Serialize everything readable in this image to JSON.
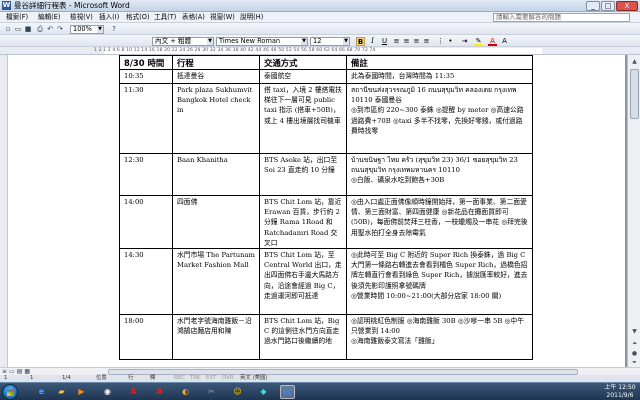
{
  "window": {
    "title": "曼谷詳細行程表 - Microsoft Word",
    "buttons": {
      "minimize": "_",
      "maximize": "□",
      "close": "X"
    }
  },
  "menubar": {
    "items": [
      "檔案(F)",
      "編輯(E)",
      "檢視(V)",
      "插入(I)",
      "格式(O)",
      "工具(T)",
      "表格(A)",
      "視窗(W)",
      "說明(H)"
    ],
    "help_placeholder": "請輸入需要解答的問題"
  },
  "toolbar": {
    "zoom": "100%",
    "style": "內文 + 粗體",
    "font": "Times New Roman",
    "font_size": "12",
    "bold": "B",
    "italic": "I",
    "underline": "U",
    "char_a": "A"
  },
  "ruler": {
    "numbers": "1  2  1      2  4  6  8  10  12  14  16  18  20  22  24  26  28  30  32  34  36  38  40  42  44  46  48  50  52  54  56  58  60  62  64  66  68  70  72  74"
  },
  "document": {
    "headers": [
      "8/30 時間",
      "行程",
      "交通方式",
      "備註"
    ],
    "rows": [
      {
        "time": "10:35",
        "itinerary": "抵達曼谷",
        "transport": "泰國航空",
        "notes": "此為泰國時間，台灣時間為 11:35"
      },
      {
        "time": "11:30",
        "itinerary": "Park plaza Sukhumvit Bangkok Hotel check in",
        "transport": "搭 taxi，入境 2 樓搭電扶梯往下一層可見 public taxi 指示 (搭車+50B)，或上 4 樓出境層找司機車",
        "notes": "สถานีขนส่งสุวรรณภูมิ 16 ถนนสุขุมวิท คลองเตย กรุงเทพ 10110 泰國曼谷\n◎到市區約 220~300 泰銖 ◎提醒 by meter ◎高速公路過路費+70B ◎taxi 多半不找零，先換好零錢，或付過路費時找零"
      },
      {
        "time": "12:30",
        "itinerary": "Baan Khanitha",
        "transport": "BTS Asoke 站，出口至 Soi 23 直走約 10 分鐘",
        "notes": "บ้านขนิษฐา ไทย ครัว (สุขุมวิท 23) 36/1 ซอยสุขุมวิท 23 ถนนสุขุมวิท กรุงเทพมหานคร 10110\n◎白飯、礦泉水吃到飽各+30B"
      },
      {
        "time": "14:00",
        "itinerary": "四面佛",
        "transport": "BTS Chit Lom 站，靠近 Erawan 百貨，步行約 2 分鐘 Rama 1Road 和 Ratchadamri Road 交叉口",
        "notes": "◎由入口處正面佛像順時鐘開始拜，第一面事業、第二面愛情、第三面財富、第四面健康 ◎新花品在攤面買即可(50B)，每面佛前焚拜三柱香，一枝蠟燭及一串花 ◎拜完後用聖水拍打全身去除霉氣"
      },
      {
        "time": "14:30",
        "itinerary": "水門市場 The Partunam Market Fashion Mall",
        "transport": "BTS Chit Lom 站，至 Central World 出口，走出四面佛右手邊大馬路方向，沿途會經過 Big C，走過運河即可抵達",
        "notes": "◎此時可至 Big C 附近的 Super Rich 換泰銖，過 Big C 大門第一條路右轉進去會看到橘色 Super Rich，過橋色招牌左轉直行會看到綠色 Super Rich，據說匯率較好，進去後須先影印護照拿號碼牌\n◎營業時間 10:00~21:00(大部分店家 18:00 關)"
      },
      {
        "time": "18:00",
        "itinerary": "水門老字號海南雞飯－沿鴻鵠店麵店用和陳",
        "transport": "BTS Chit Lom 站，Big C 的這側往水門方向直走過水門路口後繼續的地",
        "notes": "◎認明桃紅色制服 ◎海南雞飯 30B ◎沙嗲一串 5B ◎中午只營業到 14:00\n◎海南雞飯泰文寫法「雞飯」"
      }
    ]
  },
  "statusbar": {
    "page": "1",
    "section": "1",
    "page_of": "1/4",
    "position": "位置",
    "line": "行",
    "column": "欄",
    "rec": "REC",
    "trk": "TRK",
    "ext": "EXT",
    "ovr": "OVR",
    "language": "英文 (美國)"
  },
  "taskbar": {
    "time": "上午 12:50",
    "date": "2011/9/6"
  },
  "icon_names": [
    "word-icon",
    "minimize-icon",
    "maximize-icon",
    "close-icon",
    "new-doc-icon",
    "open-icon",
    "save-icon",
    "print-icon",
    "undo-icon",
    "redo-icon",
    "start-icon",
    "ie-icon",
    "explorer-icon",
    "media-icon",
    "acrobat-icon",
    "word-taskbar-icon"
  ]
}
